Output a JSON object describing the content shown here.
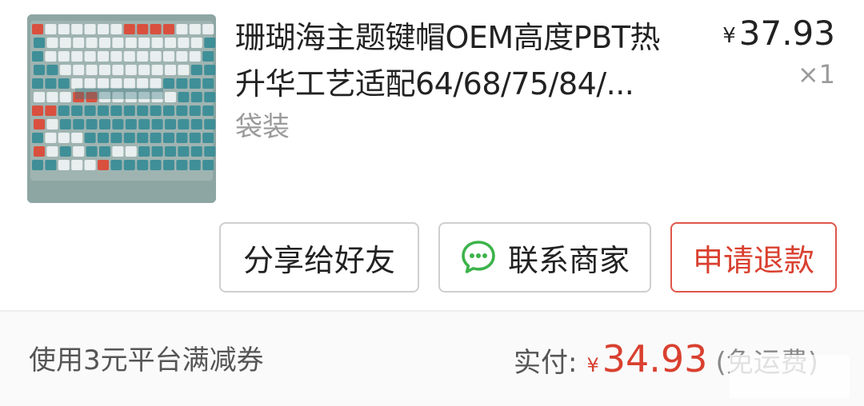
{
  "product": {
    "image_alt": "珊瑚海主题键帽键盘图片",
    "title_line1": "珊瑚海主题键帽OEM高度PBT热",
    "title_line2": "升华工艺适配64/68/75/84/...",
    "spec": "袋装",
    "price_symbol": "¥",
    "price": "37.93",
    "quantity": "×1"
  },
  "actions": {
    "share": "分享给好友",
    "contact": "联系商家",
    "refund": "申请退款"
  },
  "footer": {
    "coupon_text": "使用3元平台满减券",
    "paid_label": "实付:",
    "paid_symbol": "¥",
    "paid_amount": "34.93",
    "paid_note": "(免运费)"
  },
  "colors": {
    "accent_red": "#d9402f",
    "wechat_green": "#3cb34a"
  },
  "icons": {
    "contact": "wechat-chat-icon"
  }
}
